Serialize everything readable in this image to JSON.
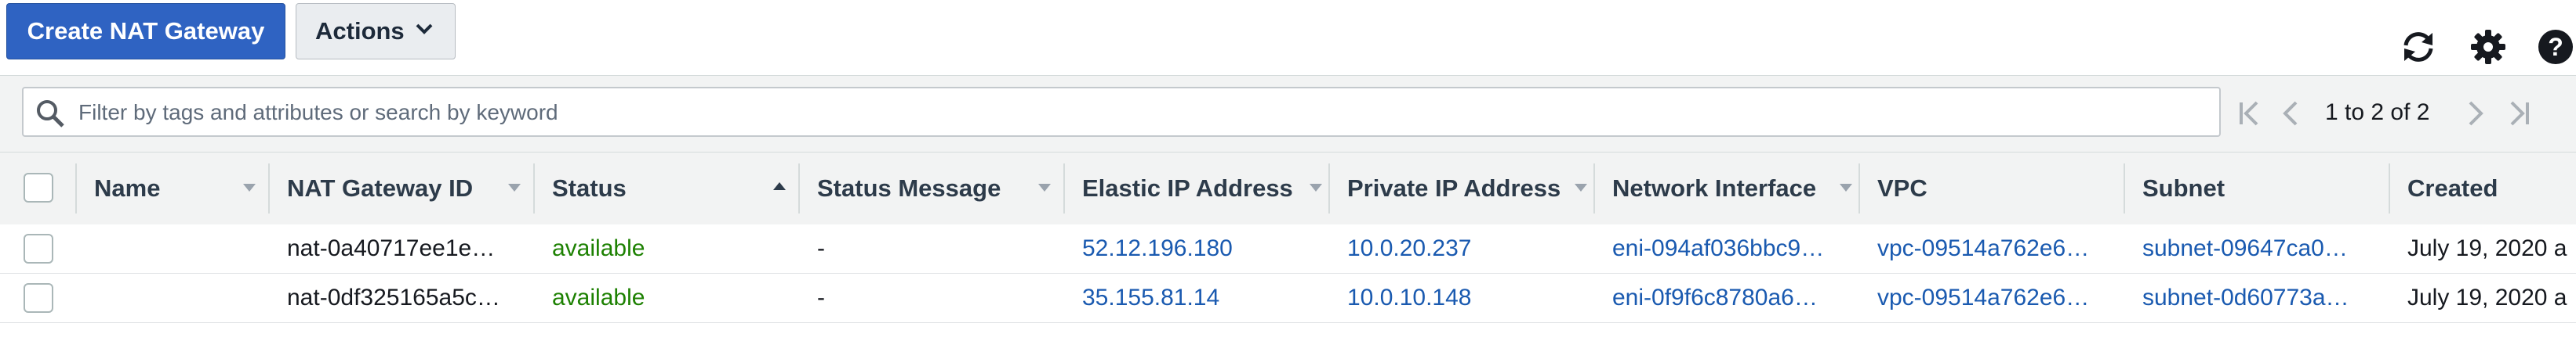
{
  "toolbar": {
    "create_label": "Create NAT Gateway",
    "actions_label": "Actions"
  },
  "filter": {
    "placeholder": "Filter by tags and attributes or search by keyword",
    "pagination": "1 to 2 of 2"
  },
  "columns": [
    "Name",
    "NAT Gateway ID",
    "Status",
    "Status Message",
    "Elastic IP Address",
    "Private IP Address",
    "Network Interface",
    "VPC",
    "Subnet",
    "Created"
  ],
  "sort": {
    "column": "Status",
    "direction": "ascending"
  },
  "rows": [
    {
      "name": "",
      "id": "nat-0a40717ee1e…",
      "status": "available",
      "message": "-",
      "eip": "52.12.196.180",
      "private_ip": "10.0.20.237",
      "eni": "eni-094af036bbc9…",
      "vpc": "vpc-09514a762e6…",
      "subnet": "subnet-09647ca0…",
      "created": "July 19, 2020 a"
    },
    {
      "name": "",
      "id": "nat-0df325165a5c…",
      "status": "available",
      "message": "-",
      "eip": "35.155.81.14",
      "private_ip": "10.0.10.148",
      "eni": "eni-0f9f6c8780a6…",
      "vpc": "vpc-09514a762e6…",
      "subnet": "subnet-0d60773a…",
      "created": "July 19, 2020 a"
    }
  ],
  "colors": {
    "primary_button": "#2f63c2",
    "link": "#1a5ab0",
    "status_available": "#1d8102"
  },
  "icons": [
    "refresh-icon",
    "settings-gear-icon",
    "help-icon",
    "search-icon",
    "first-page-icon",
    "prev-page-icon",
    "next-page-icon",
    "last-page-icon",
    "chevron-down-icon"
  ]
}
